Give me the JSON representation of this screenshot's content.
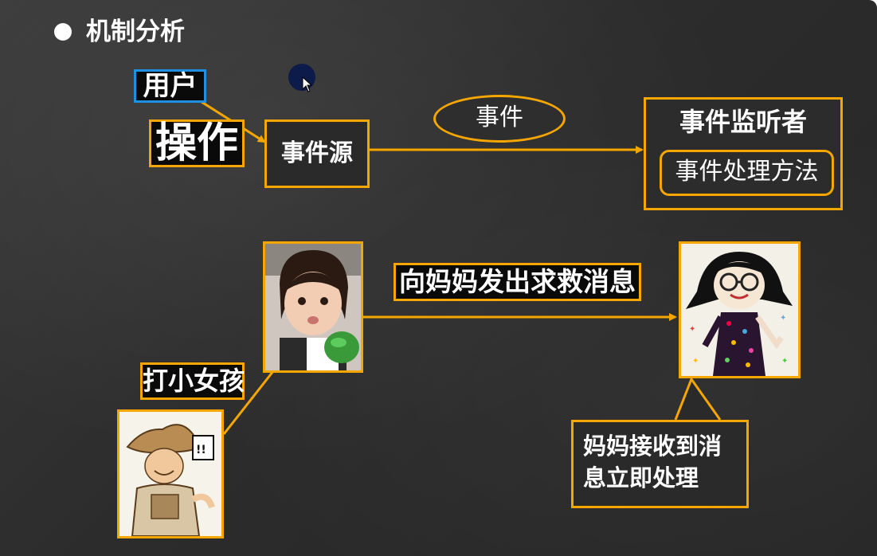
{
  "slide": {
    "title": "机制分析"
  },
  "diagram": {
    "user_label": "用户",
    "operation_label": "操作",
    "event_source_label": "事件源",
    "event_label": "事件",
    "listener_title": "事件监听者",
    "handler_label": "事件处理方法"
  },
  "story": {
    "message_label": "向妈妈发出求救消息",
    "hit_label": "打小女孩",
    "callout_text": "妈妈接收到消息立即处理"
  },
  "colors": {
    "accent": "#f5a700",
    "user_border": "#1e90e0",
    "background": "#2e2e2e",
    "text": "#ffffff"
  },
  "icons": {
    "bullet": "bullet-dot-icon",
    "cursor": "mouse-pointer-icon"
  }
}
